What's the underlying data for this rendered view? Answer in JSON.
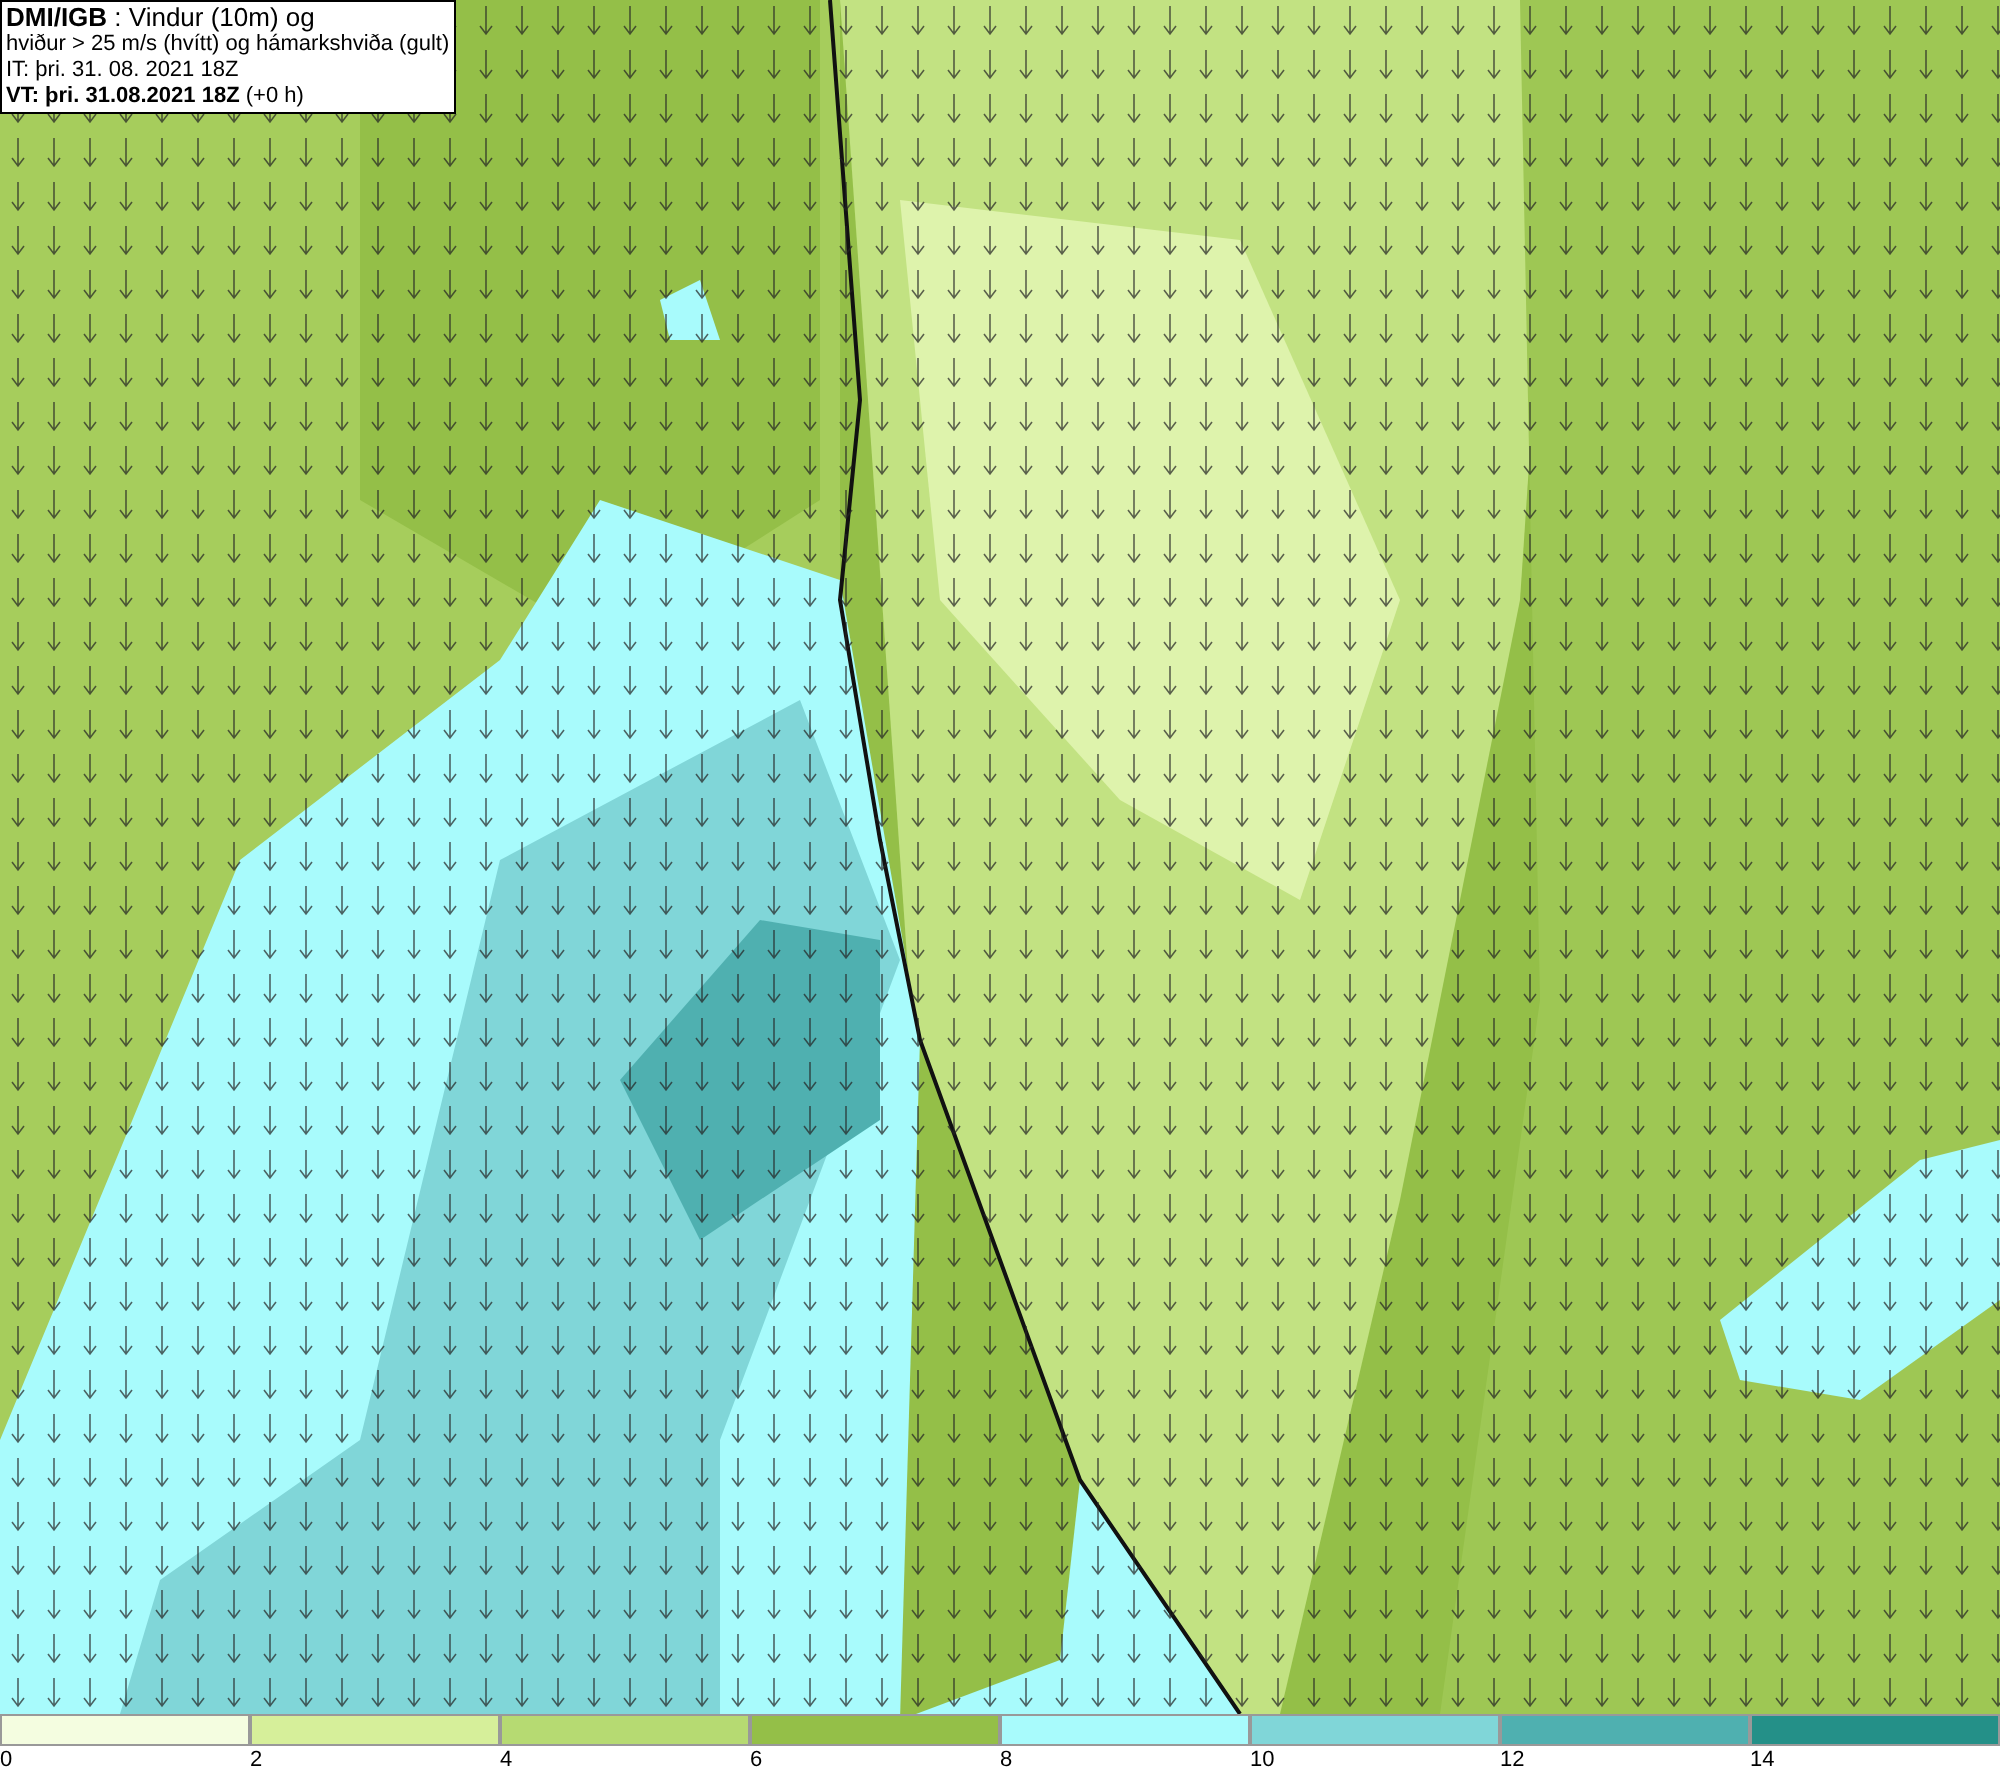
{
  "info_box": {
    "lines": [
      "**DMI/IGB** : Vindur (10m) og",
      "hviður > 25 m/s (hvítt) og hámarkshviða (gult)",
      "IT: þri. 31. 08. 2021 18Z",
      "**VT: þri. 31.08.2021 18Z** (+0 h)"
    ]
  },
  "legend": [
    {
      "label": "0",
      "color": "#f4fde0"
    },
    {
      "label": "2",
      "color": "#d6ef9a"
    },
    {
      "label": "4",
      "color": "#b6da72"
    },
    {
      "label": "6",
      "color": "#94bf48"
    },
    {
      "label": "8",
      "color": "#a8fbfc"
    },
    {
      "label": "10",
      "color": "#80d6d8"
    },
    {
      "label": "12",
      "color": "#4fb0b0"
    },
    {
      "label": "14",
      "color": "#249088"
    }
  ]
}
